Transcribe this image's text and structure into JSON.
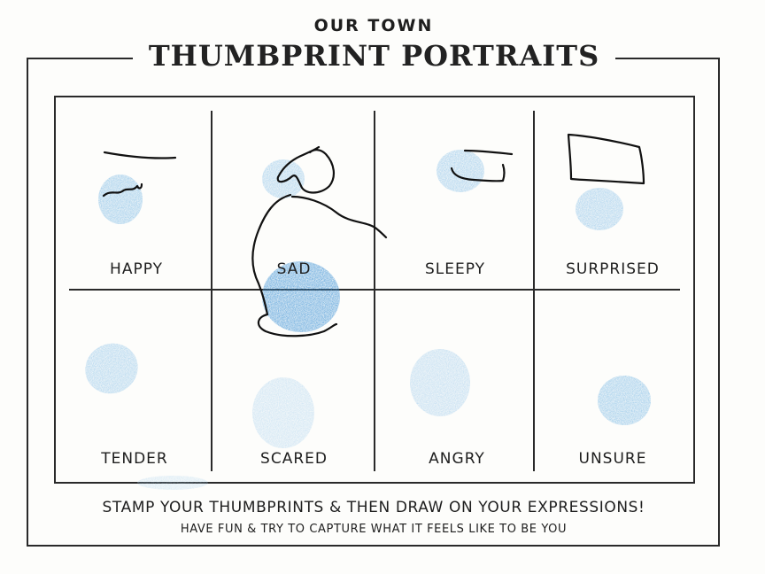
{
  "header": {
    "subtitle": "OUR TOWN",
    "title": "THUMBPRINT PORTRAITS"
  },
  "emotions": [
    "HAPPY",
    "SAD",
    "SLEEPY",
    "SURPRISED",
    "TENDER",
    "SCARED",
    "ANGRY",
    "UNSURE"
  ],
  "instructions": {
    "main": "STAMP YOUR THUMBPRINTS & THEN DRAW ON YOUR EXPRESSIONS!",
    "sub": "HAVE FUN & TRY TO CAPTURE  WHAT IT FEELS LIKE TO BE YOU"
  },
  "colors": {
    "ink": "#6fb0e0",
    "ink_dark": "#3f93d6",
    "line": "#2a2a2a",
    "paper": "#fdfdfb"
  }
}
